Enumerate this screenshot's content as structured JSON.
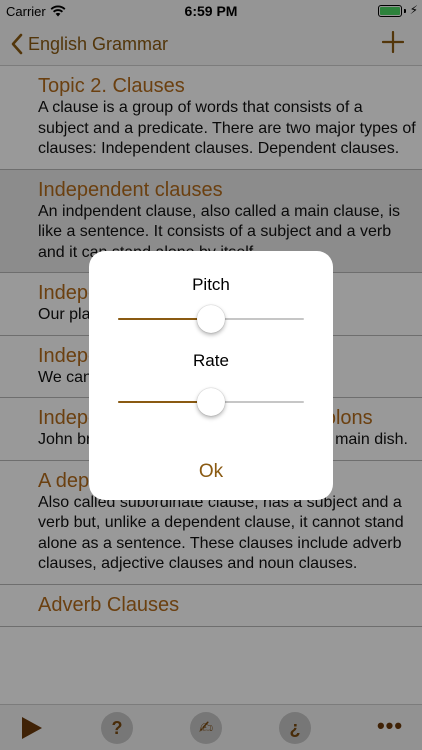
{
  "status": {
    "carrier": "Carrier",
    "time": "6:59 PM"
  },
  "nav": {
    "back_label": "English Grammar"
  },
  "items": [
    {
      "title": "Topic 2. Clauses",
      "body": " A clause is a group of words that consists of a subject and a predicate. There are two major types of clauses: Independent clauses. Dependent clauses."
    },
    {
      "title": "Independent clauses",
      "body": " An indpendent clause, also called a main clause, is like a sentence. It consists of a subject and a verb and it can stand alone by itself."
    },
    {
      "title": "Independent clause",
      "body": " Our plane was delayed."
    },
    {
      "title": "Independent clauses 2",
      "body": " We can join two independent clauses."
    },
    {
      "title": "Independent clauses with Semicolons",
      "body": " John brought the salad; Mary brought the main dish."
    },
    {
      "title": "A dependent clause",
      "body": " Also called subordinate clause, has a subject and a verb but, unlike a dependent clause, it cannot stand alone as a sentence. These clauses include adverb clauses, adjective clauses and noun clauses."
    },
    {
      "title": "Adverb Clauses",
      "body": ""
    }
  ],
  "tabs": {
    "help": "?",
    "write": "✍",
    "quiz": "¿",
    "more": "•••"
  },
  "dialog": {
    "pitch_label": "Pitch",
    "pitch_value": 0.5,
    "rate_label": "Rate",
    "rate_value": 0.5,
    "ok_label": "Ok"
  },
  "colors": {
    "accent": "#8a5a12",
    "title": "#b36b1b"
  }
}
